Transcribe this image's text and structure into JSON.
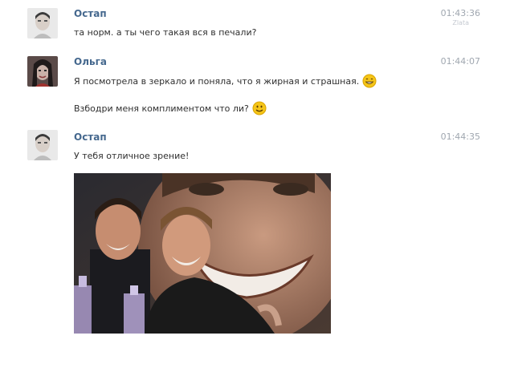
{
  "messages": [
    {
      "author": "Остап",
      "time": "01:43:36",
      "status": "Zlata",
      "lines": [
        "та норм. а ты чего такая вся в печали?"
      ]
    },
    {
      "author": "Ольга",
      "time": "01:44:07",
      "lines": [
        "Я посмотрела в зеркало и поняла, что я жирная и страшная.",
        "Взбодри меня комплиментом что ли?"
      ],
      "emoji": [
        "grin-smiley-icon",
        "smile-smiley-icon"
      ]
    },
    {
      "author": "Остап",
      "time": "01:44:35",
      "lines": [
        "У тебя отличное зрение!"
      ],
      "attachment": "laughing-men-photo"
    }
  ],
  "colors": {
    "author": "#45688e",
    "time": "#a0a7b0",
    "text": "#2f2f2f",
    "smiley": "#f5c518"
  }
}
